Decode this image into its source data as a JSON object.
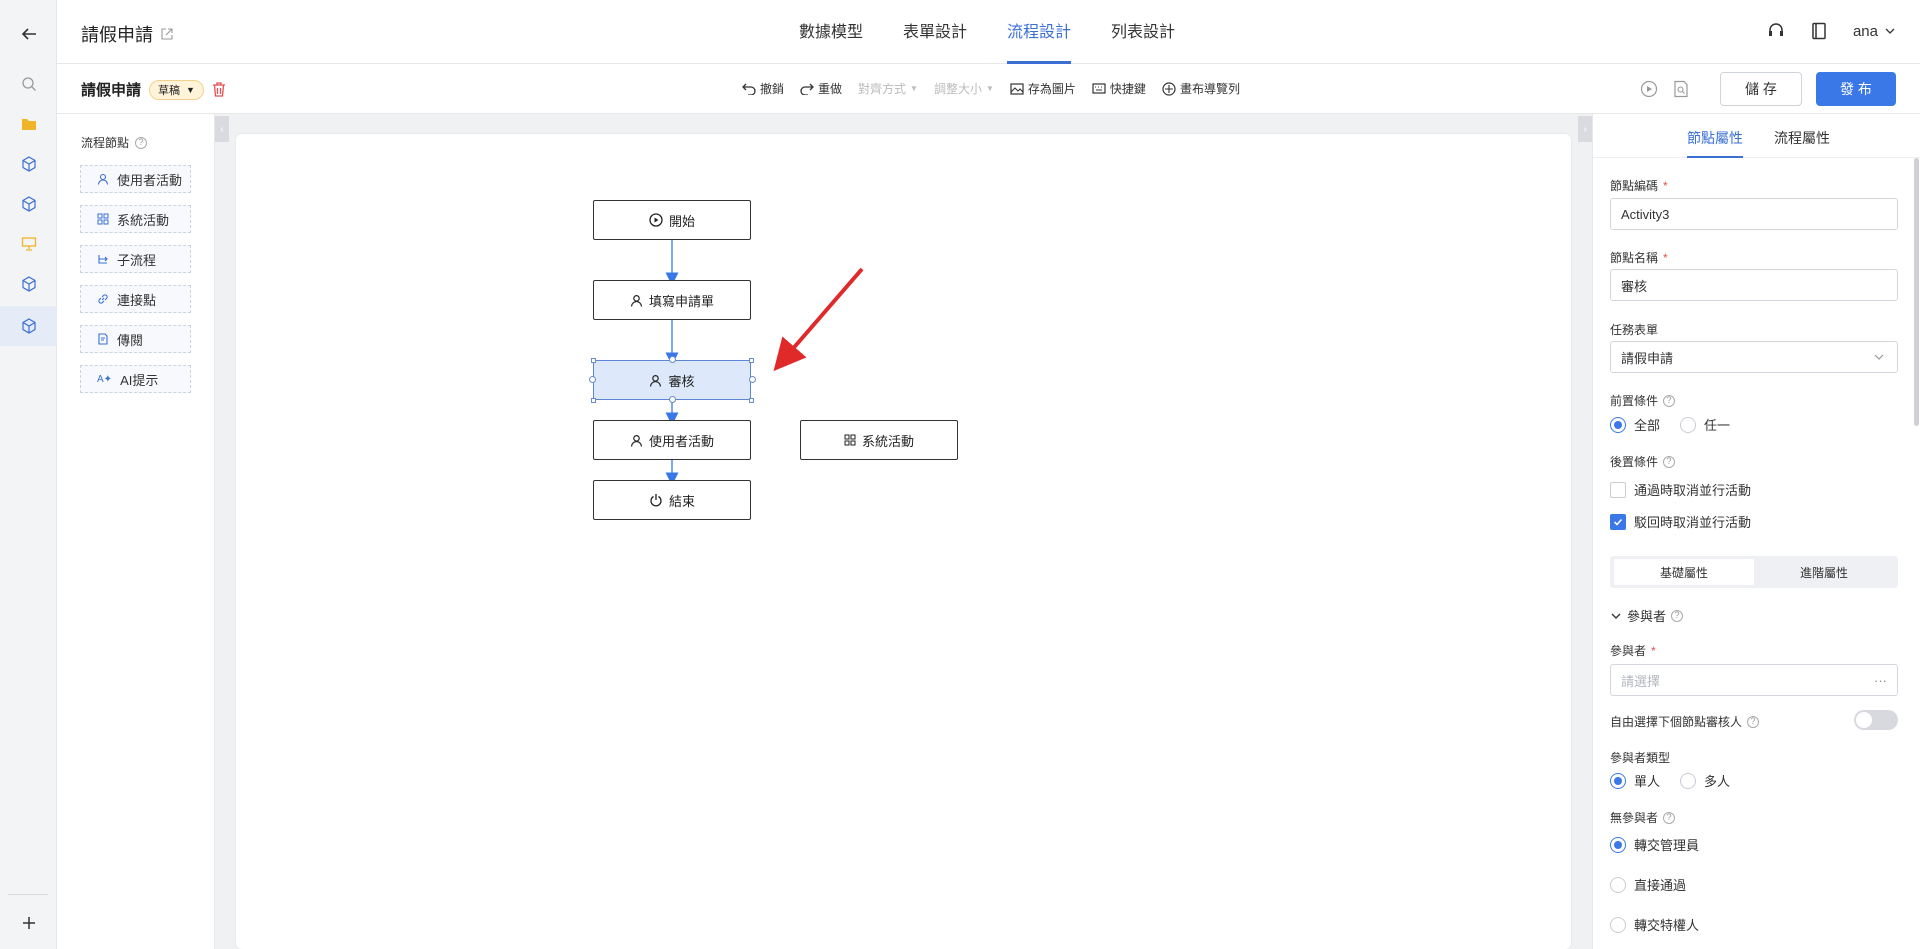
{
  "app": {
    "title": "請假申請",
    "top_tabs": [
      "數據模型",
      "表單設計",
      "流程設計",
      "列表設計"
    ],
    "active_tab": "流程設計",
    "user": "ana"
  },
  "subbar": {
    "title": "請假申請",
    "status_badge": "草稿",
    "tools": {
      "undo": "撤銷",
      "redo": "重做",
      "align": "對齊方式",
      "resize": "調整大小",
      "save_image": "存為圖片",
      "shortcuts": "快捷鍵",
      "canvas_nav": "畫布導覽列"
    },
    "save_label": "儲 存",
    "publish_label": "發 布"
  },
  "palette": {
    "title": "流程節點",
    "items": [
      "使用者活動",
      "系統活動",
      "子流程",
      "連接點",
      "傳閱",
      "AI提示"
    ]
  },
  "canvas": {
    "nodes": {
      "start": "開始",
      "fill_form": "填寫申請單",
      "review": "審核",
      "user_activity": "使用者活動",
      "system_activity": "系統活動",
      "end": "結束"
    }
  },
  "panel": {
    "tabs": [
      "節點屬性",
      "流程屬性"
    ],
    "node_code_label": "節點編碼",
    "node_code_value": "Activity3",
    "node_name_label": "節點名稱",
    "node_name_value": "審核",
    "task_form_label": "任務表單",
    "task_form_value": "請假申請",
    "precondition_label": "前置條件",
    "precondition_options": [
      "全部",
      "任一"
    ],
    "postcondition_label": "後置條件",
    "post_opt1": "通過時取消並行活動",
    "post_opt2": "駁回時取消並行活動",
    "seg_basic": "基礎屬性",
    "seg_advanced": "進階屬性",
    "participants_section": "參與者",
    "participants_label": "參與者",
    "participants_placeholder": "請選擇",
    "free_select_label": "自由選擇下個節點審核人",
    "participant_type_label": "參與者類型",
    "participant_type_options": [
      "單人",
      "多人"
    ],
    "no_participant_label": "無參與者",
    "no_participant_options": [
      "轉交管理員",
      "直接通過",
      "轉交特權人"
    ]
  },
  "colors": {
    "accent": "#3b78e7",
    "arrow": "#e02a2a"
  }
}
